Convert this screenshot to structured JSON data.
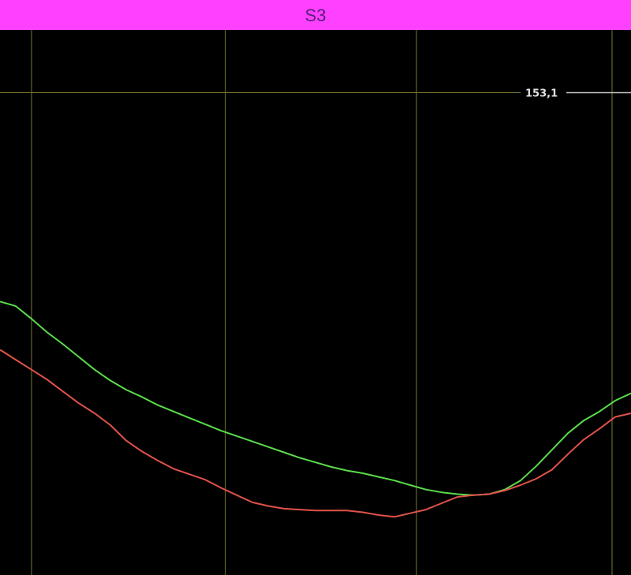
{
  "header": {
    "title": "S3",
    "background": "#ff40ff",
    "text_color": "#5a1e7a"
  },
  "colors": {
    "background": "#000000",
    "gridline": "#7a7a30",
    "reference_line": "#c8c8c8",
    "reference_label": "#e0e0e0"
  },
  "chart_data": {
    "type": "line",
    "title": "S3",
    "xlabel": "",
    "ylabel": "",
    "grid": true,
    "xlim": [
      0,
      100
    ],
    "ylim": [
      100,
      160
    ],
    "x_gridlines": [
      5,
      35.7,
      66,
      97
    ],
    "reference_line": {
      "value": 153.1,
      "label": "153,1"
    },
    "x": [
      0,
      2.5,
      5,
      7.5,
      10,
      12.5,
      15,
      17.5,
      20,
      22.5,
      25,
      27.5,
      30,
      32.5,
      35,
      37.5,
      40,
      42.5,
      45,
      47.5,
      50,
      52.5,
      55,
      57.5,
      60,
      62.5,
      65,
      67.5,
      70,
      72.5,
      75,
      77.5,
      80,
      82.5,
      85,
      87.5,
      90,
      92.5,
      95,
      97.5,
      100
    ],
    "series": [
      {
        "color": "#5adc4a",
        "values": [
          130.1,
          129.6,
          128.2,
          126.7,
          125.4,
          124.0,
          122.6,
          121.4,
          120.4,
          119.6,
          118.7,
          118.0,
          117.3,
          116.6,
          115.9,
          115.3,
          114.7,
          114.1,
          113.5,
          112.9,
          112.4,
          111.9,
          111.5,
          111.2,
          110.8,
          110.4,
          109.9,
          109.4,
          109.1,
          108.9,
          108.8,
          108.9,
          109.4,
          110.4,
          112.0,
          113.8,
          115.6,
          117.0,
          118.0,
          119.2,
          120.0
        ]
      },
      {
        "color": "#e0524a",
        "values": [
          124.8,
          123.7,
          122.6,
          121.5,
          120.2,
          118.9,
          117.8,
          116.5,
          114.8,
          113.6,
          112.6,
          111.7,
          111.1,
          110.5,
          109.6,
          108.8,
          108.0,
          107.6,
          107.3,
          107.2,
          107.1,
          107.1,
          107.1,
          106.9,
          106.6,
          106.4,
          106.8,
          107.2,
          107.9,
          108.6,
          108.8,
          108.9,
          109.3,
          109.9,
          110.6,
          111.6,
          113.3,
          114.9,
          116.1,
          117.4,
          117.8
        ]
      }
    ]
  }
}
